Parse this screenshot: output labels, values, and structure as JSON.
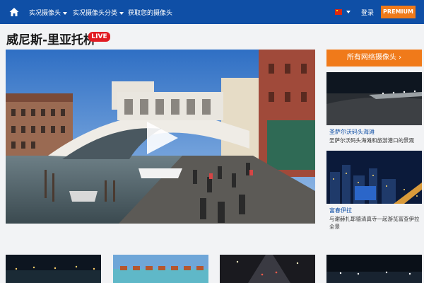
{
  "navbar": {
    "home_icon": "home-icon",
    "items": [
      {
        "label": "实况摄像头"
      },
      {
        "label": "实况摄像头分类"
      },
      {
        "label": "获取您的摄像头"
      }
    ],
    "language_flag": "china-flag-icon",
    "login_label": "登录",
    "premium_label": "PREMIUM"
  },
  "page": {
    "title": "威尼斯-里亚托桥",
    "live_badge": "LIVE"
  },
  "sidebar": {
    "all_cams_label": "所有网络摄像头 ›",
    "cams": [
      {
        "title": "圣萨尔沃码头海滩",
        "desc": "圣萨尔沃码头海滩和旅游港口的景观"
      },
      {
        "title": "富春伊拉",
        "desc": "与谢赫扎耶德清真寺一起游览富查伊拉全景"
      }
    ]
  },
  "colors": {
    "nav_bg": "#0f4fa6",
    "accent_orange": "#f07a1a",
    "live_red": "#e11b22"
  }
}
